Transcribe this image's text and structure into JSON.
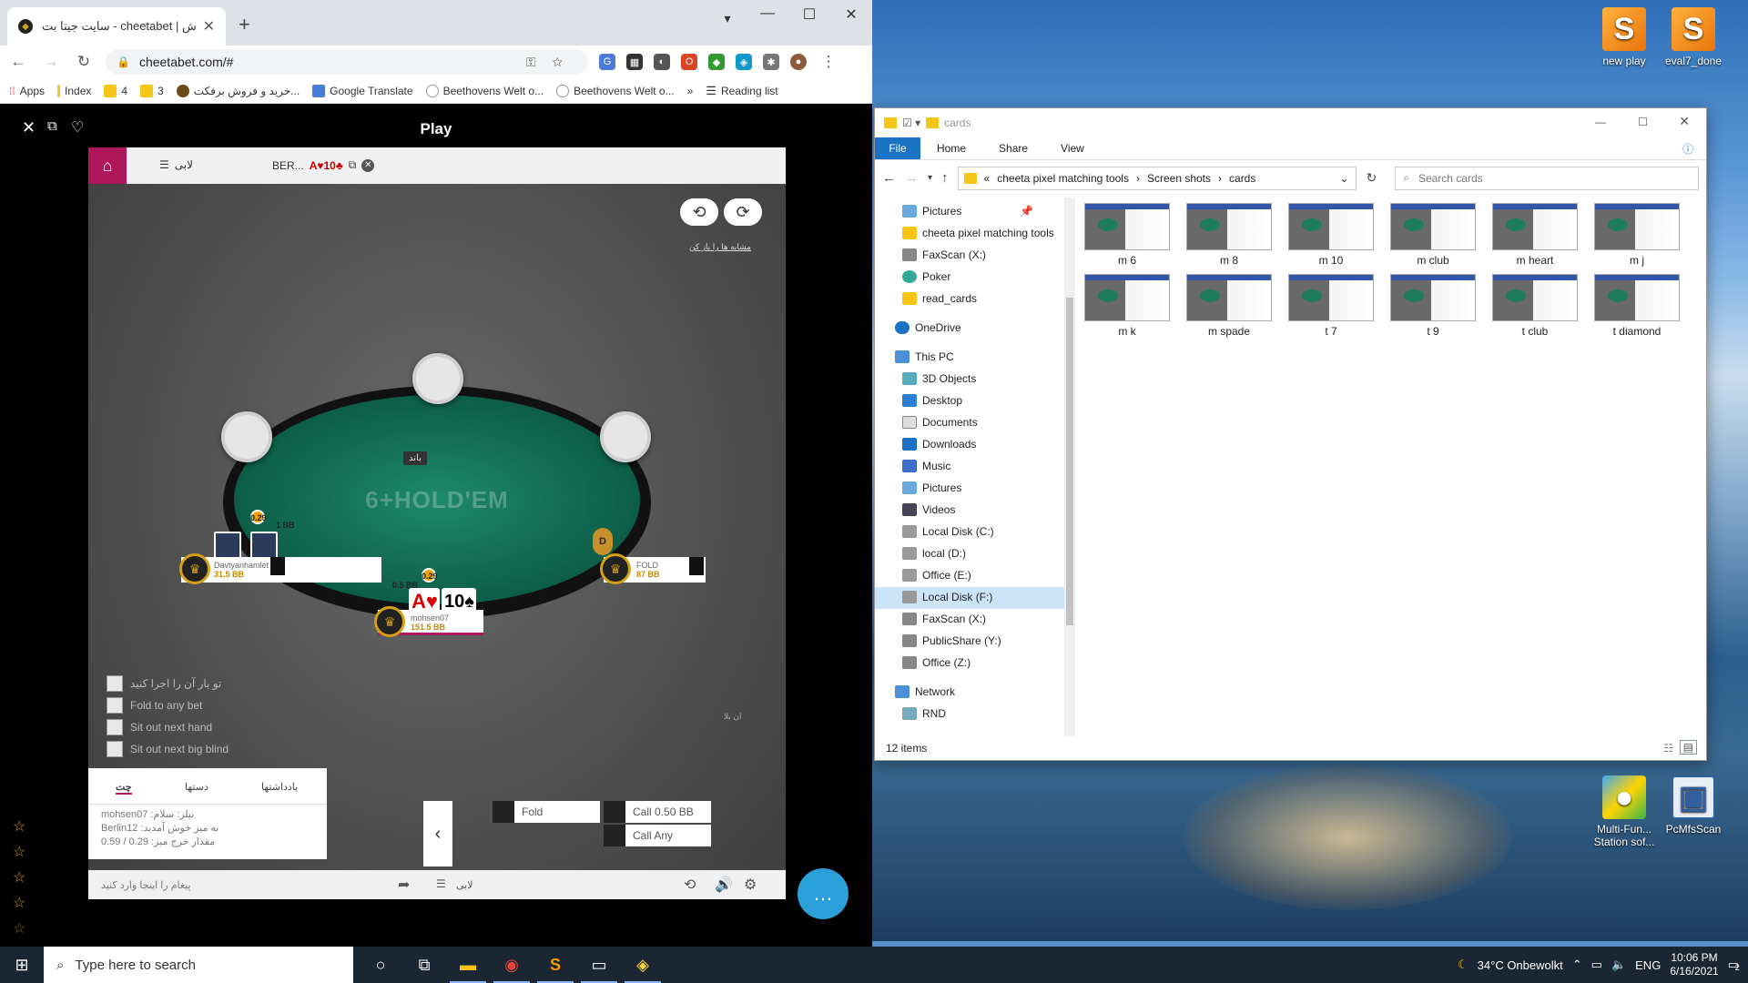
{
  "browser": {
    "tab_title": "سایت جیتا بت - cheetabet | سایت ش",
    "url": "cheetabet.com/#",
    "bookmarks": [
      "Apps",
      "Index",
      "4",
      "3",
      "خرید و فروش برفکت...",
      "Google Translate",
      "Beethovens Welt o...",
      "Beethovens Welt o..."
    ],
    "reading_list": "Reading list",
    "overflow": "»"
  },
  "game": {
    "header_title": "Play",
    "tab_lobby": "لابی",
    "tab_table": "BER...",
    "tab_cards": "A♥10♣",
    "small_info": "مشابه ها را باز کن",
    "pot_label": "باند",
    "logo": "6+HOLD'EM",
    "players": [
      {
        "name": "Davtyanhamlet",
        "stack": "31.5 BB",
        "bet": "0.29",
        "extra": "1 BB"
      },
      {
        "name": "mohsen07",
        "stack": "151.5 BB",
        "bet": "0.29",
        "extra": "0.5 BB"
      },
      {
        "name": "FOLD",
        "stack": "87 BB",
        "dealer": "D"
      }
    ],
    "hero_cards": [
      "A♥",
      "10♠"
    ],
    "options": [
      "تو بار آن را اجرا کنید",
      "Fold to any bet",
      "Sit out next hand",
      "Sit out next big blind"
    ],
    "side_note": "ان بلا",
    "chat_tabs": [
      "چت",
      "دستها",
      "یادداشتها"
    ],
    "chat_lines": [
      "mohsen07 :نیلز: سلام",
      "Berlin12 :به میز خوش آمدید",
      "مقدار خرج میز: 0.29 / 0.59"
    ],
    "actions": {
      "fold": "Fold",
      "call": "Call 0.50 BB",
      "call_any": "Call Any"
    },
    "bottom_input": "پیغام را اینجا وارد کنید",
    "bottom_lobby": "لابی"
  },
  "explorer": {
    "title": "cards",
    "ribbon": [
      "File",
      "Home",
      "Share",
      "View"
    ],
    "path": [
      "cheeta pixel matching tools",
      "Screen shots",
      "cards"
    ],
    "search_placeholder": "Search cards",
    "nav": [
      "Pictures",
      "cheeta pixel matching tools",
      "FaxScan (X:)",
      "Poker",
      "read_cards",
      "OneDrive",
      "This PC",
      "3D Objects",
      "Desktop",
      "Documents",
      "Downloads",
      "Music",
      "Pictures",
      "Videos",
      "Local Disk (C:)",
      "local (D:)",
      "Office (E:)",
      "Local Disk (F:)",
      "FaxScan (X:)",
      "PublicShare (Y:)",
      "Office (Z:)",
      "Network",
      "RND"
    ],
    "files": [
      "m 6",
      "m 8",
      "m 10",
      "m club",
      "m heart",
      "m j",
      "m k",
      "m spade",
      "t 7",
      "t 9",
      "t club",
      "t diamond"
    ],
    "status": "12 items"
  },
  "desktop": {
    "icons": [
      "new play",
      "eval7_done",
      "Multi-Fun... Station sof...",
      "PcMfsScan"
    ]
  },
  "taskbar": {
    "search": "Type here to search",
    "weather": "34°C  Onbewolkt",
    "lang": "ENG",
    "time": "10:06 PM",
    "date": "6/16/2021",
    "notif": "2"
  }
}
